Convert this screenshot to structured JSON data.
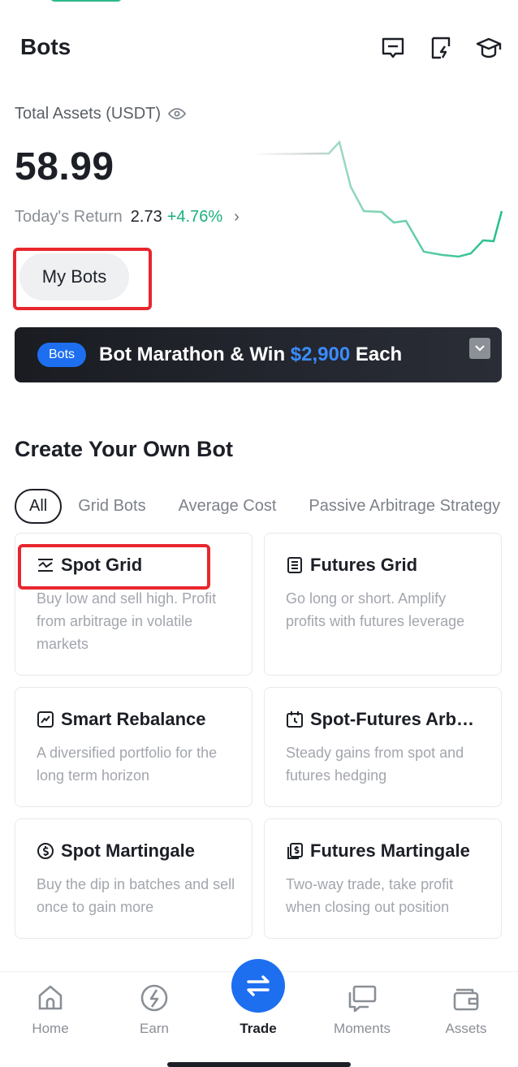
{
  "header": {
    "title": "Bots",
    "icons": [
      "message-icon",
      "bot-quick-icon",
      "academy-icon"
    ]
  },
  "assets": {
    "label": "Total Assets (USDT)",
    "value": "58.99",
    "return_label": "Today's Return",
    "return_value": "2.73",
    "return_pct": "+4.76%"
  },
  "my_bots_label": "My Bots",
  "banner": {
    "tag": "Bots",
    "text_prefix": "Bot Marathon & Win ",
    "amount": "$2,900",
    "text_suffix": " Each"
  },
  "section_title": "Create Your Own Bot",
  "tabs": [
    "All",
    "Grid Bots",
    "Average Cost",
    "Passive Arbitrage Strategy"
  ],
  "cards": [
    {
      "title": "Spot Grid",
      "icon": "spot-grid-icon",
      "desc": "Buy low and sell high. Profit from arbitrage in volatile markets"
    },
    {
      "title": "Futures Grid",
      "icon": "futures-grid-icon",
      "desc": "Go long or short. Amplify profits with futures leverage"
    },
    {
      "title": "Smart Rebalance",
      "icon": "rebalance-icon",
      "desc": "A diversified portfolio for the long term horizon"
    },
    {
      "title": "Spot-Futures Arb…",
      "icon": "arbitrage-icon",
      "desc": "Steady gains from spot and futures hedging"
    },
    {
      "title": "Spot Martingale",
      "icon": "spot-martingale-icon",
      "desc": "Buy the dip in batches and sell once to gain more"
    },
    {
      "title": "Futures Martingale",
      "icon": "futures-martingale-icon",
      "desc": "Two-way trade, take profit when closing out position"
    }
  ],
  "nav": {
    "home": "Home",
    "earn": "Earn",
    "trade": "Trade",
    "moments": "Moments",
    "assets": "Assets"
  },
  "colors": {
    "accent": "#1d6ff0",
    "positive": "#19b07c",
    "highlight": "#e8262e",
    "chart_line": "#22c08a"
  }
}
